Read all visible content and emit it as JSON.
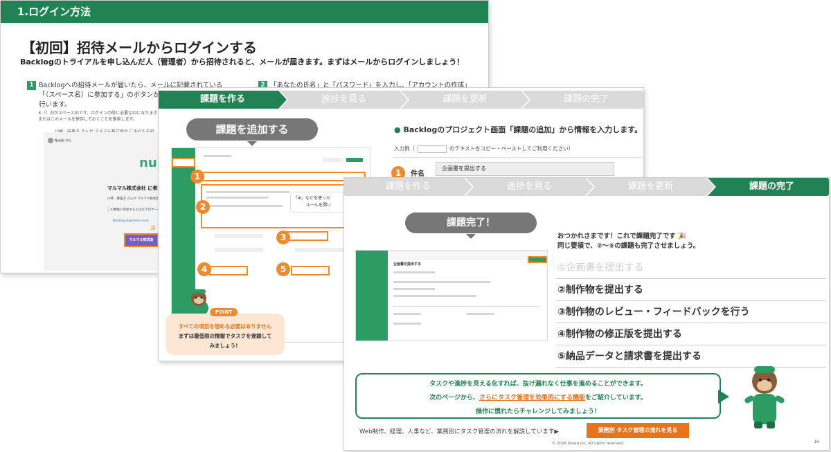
{
  "slide1": {
    "header": "1.ログイン方法",
    "title": "【初回】招待メールからログインする",
    "subtitle": "Backlogのトライアルを申し込んだ人（管理者）から招待されると、メールが届きます。まずはメールからログインしましょう！",
    "step1_num": "1",
    "step1_line1": "Backlogへの招待メールが届いたら、メールに記載されている",
    "step1_line2": "「（スペース名）に参加する」のボタンから",
    "step1_line3": "行います。",
    "step2_num": "2",
    "step2_text": "「あなたの氏名」と「パスワード」を入力し、「アカウントの作成」",
    "note_line1": "※（）内がスペースIDです。ログインの際に必要なIDになります",
    "note_line2": "またはこのメールを保存しておくことを推奨します。",
    "mail_from": "川崎　麻里子 さんが マルマル株式会社 にあなたを招",
    "mail_sender": "Nulab Inc.",
    "mail_logo": "nul",
    "mail_company": "マルマル株式会社 に参加",
    "mail_text1": "川崎　麻里子 さんが マルマル株式会社",
    "mail_text2": "この機能に参加するとは以下のサービ",
    "mail_link": "Backlog (bg-demo-ma)",
    "mail_button": "マルマル株式会",
    "mail_annotation": "ス"
  },
  "slide2": {
    "tabs": [
      "課題を作る",
      "進捗を見る",
      "課題を更新",
      "課題の完了"
    ],
    "bubble": "課題を追加する",
    "heading_dot": "●",
    "heading": "Backlogのプロジェクト画面「課題の追加」から情報を入力します。",
    "example_prefix": "入力例（",
    "example_suffix": "のテキストをコピー・ペーストしてご利用ください）",
    "form_num": "1",
    "form_label": "件名",
    "form_value": "企画書を提出する",
    "markers": [
      "1",
      "2",
      "3",
      "4",
      "5"
    ],
    "tip_line1": "「#」などを使った",
    "tip_line2": "ルールを開い",
    "point_badge": "POINT",
    "point_line1": "すべての項目を埋める必要はありません",
    "point_line2": "まずは最低限の情報でタスクを登録して",
    "point_line3": "みましょう！"
  },
  "slide3": {
    "tabs": [
      "課題を作る",
      "進捗を見る",
      "課題を更新",
      "課題の完了"
    ],
    "bubble": "課題完了！",
    "message_line1": "おつかれさまです！これで課題完了です 🎉",
    "message_line2": "同じ要領で、②〜⑤の課題も完了させましょう。",
    "tasks": [
      {
        "text": "①企画書を提出する",
        "done": true
      },
      {
        "text": "②制作物を提出する",
        "done": false
      },
      {
        "text": "③制作物のレビュー・フィードバックを行う",
        "done": false
      },
      {
        "text": "④制作物の修正版を提出する",
        "done": false
      },
      {
        "text": "⑤納品データと請求書を提出する",
        "done": false
      }
    ],
    "screenshot_title": "企画書を提出する",
    "bottom_line1": "タスクや進捗を見える化すれば、抜け漏れなく仕事を進めることができます。",
    "bottom_line2_pre": "次のページから、",
    "bottom_line2_link": "さらにタスク管理を効果的にする機能",
    "bottom_line2_post": "をご紹介しています。",
    "bottom_line3": "操作に慣れたらチャレンジしてみましょう！",
    "footer_text": "Web制作、経理、人事など、業務別にタスク管理の流れを解説しています▶",
    "footer_button": "業務別 タスク管理の流れを見る",
    "copyright": "© 2026 Nulab Inc. All rights reserved.",
    "page_number": "16"
  },
  "colors": {
    "brand_green": "#218354",
    "accent_orange": "#f08a2c",
    "tab_inactive": "#dadada"
  }
}
